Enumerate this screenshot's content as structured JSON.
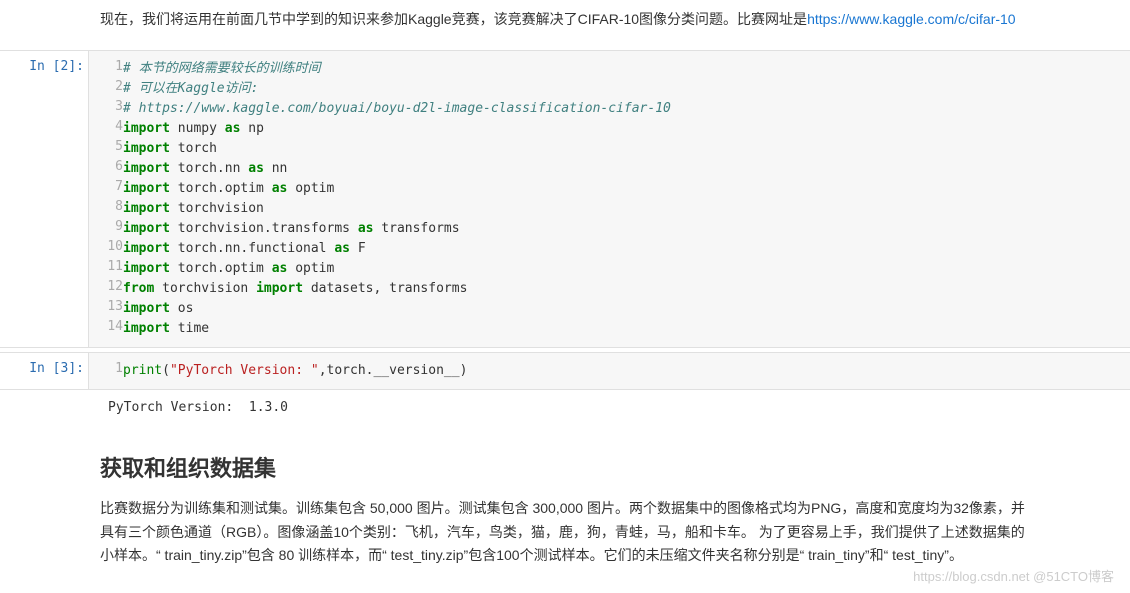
{
  "intro": {
    "pre": "现在，我们将运用在前面几节中学到的知识来参加Kaggle竞赛，该竞赛解决了CIFAR-10图像分类问题。比赛网址是",
    "link": "https://www.kaggle.com/c/cifar-10"
  },
  "cell1": {
    "prompt": "In [2]:",
    "lines": [
      [
        {
          "t": "# 本节的网络需要较长的训练时间",
          "c": "c-comment"
        }
      ],
      [
        {
          "t": "# 可以在Kaggle访问:",
          "c": "c-comment"
        }
      ],
      [
        {
          "t": "# https://www.kaggle.com/boyuai/boyu-d2l-image-classification-cifar-10",
          "c": "c-comment"
        }
      ],
      [
        {
          "t": "import",
          "c": "c-keyword"
        },
        {
          "t": " numpy ",
          "c": "c-name"
        },
        {
          "t": "as",
          "c": "c-keyword"
        },
        {
          "t": " np",
          "c": "c-name"
        }
      ],
      [
        {
          "t": "import",
          "c": "c-keyword"
        },
        {
          "t": " torch",
          "c": "c-name"
        }
      ],
      [
        {
          "t": "import",
          "c": "c-keyword"
        },
        {
          "t": " torch.nn ",
          "c": "c-name"
        },
        {
          "t": "as",
          "c": "c-keyword"
        },
        {
          "t": " nn",
          "c": "c-name"
        }
      ],
      [
        {
          "t": "import",
          "c": "c-keyword"
        },
        {
          "t": " torch.optim ",
          "c": "c-name"
        },
        {
          "t": "as",
          "c": "c-keyword"
        },
        {
          "t": " optim",
          "c": "c-name"
        }
      ],
      [
        {
          "t": "import",
          "c": "c-keyword"
        },
        {
          "t": " torchvision",
          "c": "c-name"
        }
      ],
      [
        {
          "t": "import",
          "c": "c-keyword"
        },
        {
          "t": " torchvision.transforms ",
          "c": "c-name"
        },
        {
          "t": "as",
          "c": "c-keyword"
        },
        {
          "t": " transforms",
          "c": "c-name"
        }
      ],
      [
        {
          "t": "import",
          "c": "c-keyword"
        },
        {
          "t": " torch.nn.functional ",
          "c": "c-name"
        },
        {
          "t": "as",
          "c": "c-keyword"
        },
        {
          "t": " F",
          "c": "c-name"
        }
      ],
      [
        {
          "t": "import",
          "c": "c-keyword"
        },
        {
          "t": " torch.optim ",
          "c": "c-name"
        },
        {
          "t": "as",
          "c": "c-keyword"
        },
        {
          "t": " optim",
          "c": "c-name"
        }
      ],
      [
        {
          "t": "from",
          "c": "c-keyword"
        },
        {
          "t": " torchvision ",
          "c": "c-name"
        },
        {
          "t": "import",
          "c": "c-keyword"
        },
        {
          "t": " datasets, transforms",
          "c": "c-name"
        }
      ],
      [
        {
          "t": "import",
          "c": "c-keyword"
        },
        {
          "t": " os",
          "c": "c-name"
        }
      ],
      [
        {
          "t": "import",
          "c": "c-keyword"
        },
        {
          "t": " time",
          "c": "c-name"
        }
      ]
    ]
  },
  "cell2": {
    "prompt": "In [3]:",
    "lines": [
      [
        {
          "t": "print",
          "c": "c-builtin"
        },
        {
          "t": "(",
          "c": "c-name"
        },
        {
          "t": "\"PyTorch Version: \"",
          "c": "c-string"
        },
        {
          "t": ",torch.__version__)",
          "c": "c-name"
        }
      ]
    ],
    "output": "PyTorch Version:  1.3.0"
  },
  "section": {
    "title": "获取和组织数据集",
    "body": "比赛数据分为训练集和测试集。训练集包含 50,000 图片。测试集包含 300,000 图片。两个数据集中的图像格式均为PNG，高度和宽度均为32像素，并具有三个颜色通道（RGB）。图像涵盖10个类别：飞机，汽车，鸟类，猫，鹿，狗，青蛙，马，船和卡车。 为了更容易上手，我们提供了上述数据集的小样本。“ train_tiny.zip”包含 80 训练样本，而“ test_tiny.zip”包含100个测试样本。它们的未压缩文件夹名称分别是“ train_tiny”和“ test_tiny”。"
  },
  "watermark": "https://blog.csdn.net  @51CTO博客"
}
